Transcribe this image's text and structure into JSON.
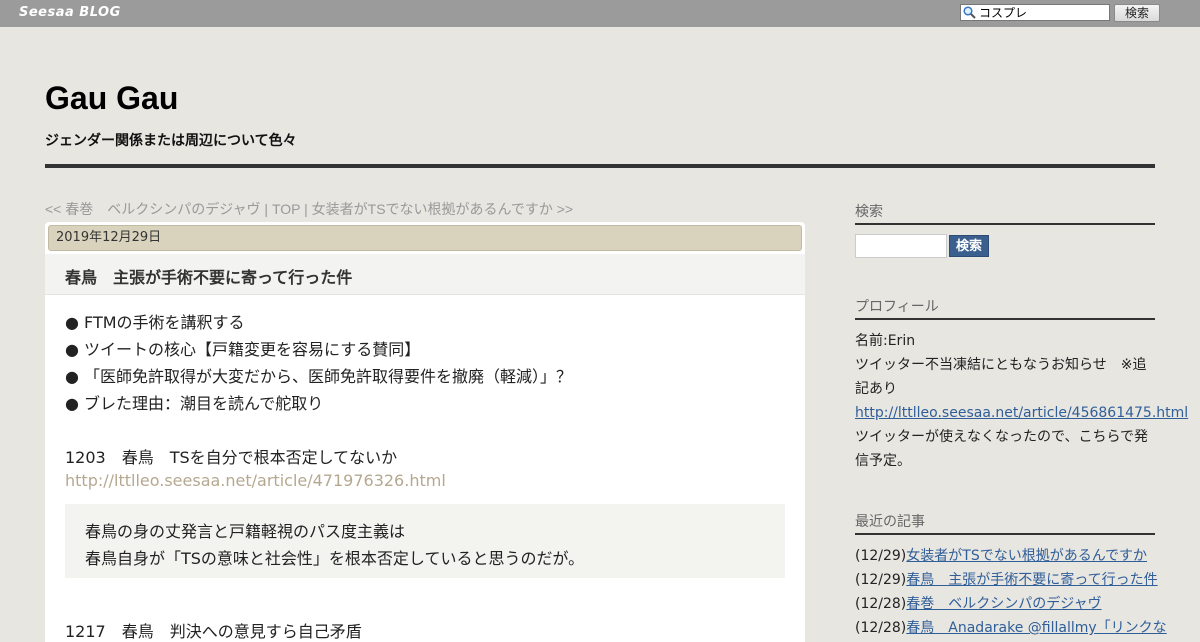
{
  "topbar": {
    "logo": "Seesaa BLOG",
    "search_value": "コスプレ",
    "search_button": "検索"
  },
  "header": {
    "title": "Gau Gau",
    "description": "ジェンダー関係または周辺について色々"
  },
  "nav": {
    "prev": "<< 春巻　ベルクシンパのデジャヴ",
    "sep1": " | ",
    "top": "TOP",
    "sep2": " | ",
    "next": "女装者がTSでない根拠があるんですか >>"
  },
  "article": {
    "date": "2019年12月29日",
    "title": "春鳥　主張が手術不要に寄って行った件",
    "bullets": [
      "● FTMの手術を講釈する",
      "● ツイートの核心【戸籍変更を容易にする賛同】",
      "● 「医師免許取得が大変だから、医師免許取得要件を撤廃（軽減）」？",
      "● ブレた理由：潮目を読んで舵取り"
    ],
    "section1_heading": "1203　春鳥　TSを自分で根本否定してないか",
    "section1_link": "http://lttlleo.seesaa.net/article/471976326.html",
    "quote_lines": [
      "春鳥の身の丈発言と戸籍軽視のパス度主義は",
      "春鳥自身が「TSの意味と社会性」を根本否定していると思うのだが。"
    ],
    "section2_heading": "1217　春鳥　判決への意見すら自己矛盾"
  },
  "sidebar": {
    "search_heading": "検索",
    "search_button": "検索",
    "profile_heading": "プロフィール",
    "profile_name": "名前:Erin",
    "profile_notice": "ツイッター不当凍結にともなうお知らせ　※追記あり",
    "profile_link": "http://lttlleo.seesaa.net/article/456861475.html",
    "profile_text": "ツイッターが使えなくなったので、こちらで発信予定。",
    "recent_heading": "最近の記事",
    "recent": [
      {
        "date": "(12/29)",
        "title": "女装者がTSでない根拠があるんですか"
      },
      {
        "date": "(12/29)",
        "title": "春鳥　主張が手術不要に寄って行った件"
      },
      {
        "date": "(12/28)",
        "title": "春巻　ベルクシンパのデジャヴ"
      },
      {
        "date": "(12/28)",
        "title": "春鳥　Anadarake @fillallmy「リンクな"
      }
    ]
  }
}
